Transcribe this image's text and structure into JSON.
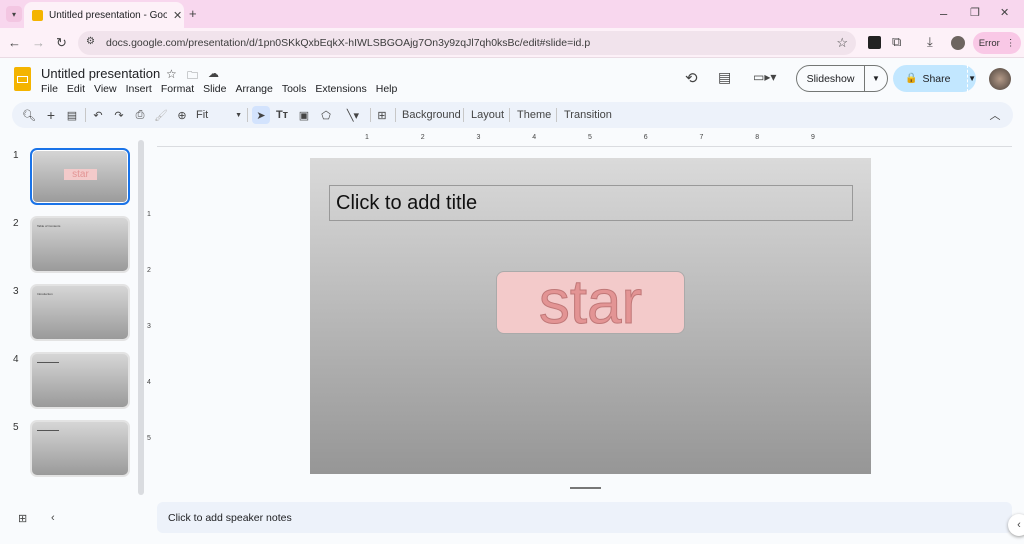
{
  "browser": {
    "tab_title": "Untitled presentation - Google",
    "url": "docs.google.com/presentation/d/1pn0SKkQxbEqkX-hIWLSBGOAjg7On3y9zqJl7qh0ksBc/edit#slide=id.p",
    "error_label": "Error"
  },
  "app": {
    "title": "Untitled presentation",
    "menus": [
      "File",
      "Edit",
      "View",
      "Insert",
      "Format",
      "Slide",
      "Arrange",
      "Tools",
      "Extensions",
      "Help"
    ],
    "slideshow_label": "Slideshow",
    "share_label": "Share"
  },
  "toolbar": {
    "zoom_value": "Fit",
    "background": "Background",
    "layout": "Layout",
    "theme": "Theme",
    "transition": "Transition"
  },
  "ruler": {
    "h": [
      "1",
      "2",
      "3",
      "4",
      "5",
      "6",
      "7",
      "8",
      "9"
    ],
    "v": [
      "1",
      "2",
      "3",
      "4",
      "5"
    ]
  },
  "slides": [
    {
      "num": "1",
      "text": "star"
    },
    {
      "num": "2",
      "text": "Table of Contents"
    },
    {
      "num": "3",
      "text": "Introduction"
    },
    {
      "num": "4",
      "text": ""
    },
    {
      "num": "5",
      "text": ""
    }
  ],
  "canvas": {
    "title_placeholder": "Click to add title",
    "shape_text": "star"
  },
  "notes": {
    "placeholder": "Click to add speaker notes"
  },
  "colors": {
    "accent": "#1a73e8",
    "share_bg": "#c2e7ff",
    "shape_fill": "#f3caca"
  }
}
